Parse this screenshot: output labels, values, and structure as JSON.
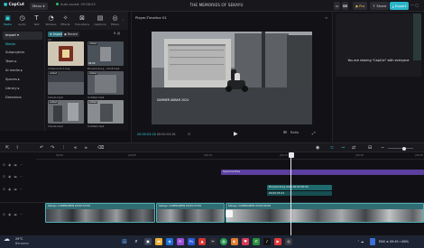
{
  "titlebar": {
    "app_name": "CapCut",
    "menu_label": "Menu",
    "autosave": "Auto saved: 09:58:53",
    "project_title": "THE MEMORIES OF SEKAYU",
    "pro_label": "Pro",
    "share_label": "Share",
    "export_label": "Export"
  },
  "media_tabs": [
    {
      "label": "Media",
      "icon": "film-icon"
    },
    {
      "label": "Audio",
      "icon": "audio-icon"
    },
    {
      "label": "Text",
      "icon": "text-icon"
    },
    {
      "label": "Stickers",
      "icon": "sticker-icon"
    },
    {
      "label": "Effects",
      "icon": "effects-icon"
    },
    {
      "label": "Transitions",
      "icon": "transition-icon"
    },
    {
      "label": "Captions",
      "icon": "caption-icon"
    },
    {
      "label": "Filters",
      "icon": "filter-icon"
    }
  ],
  "sidebar": {
    "items": [
      "Import",
      "Media",
      "Subprojects",
      "Team",
      "AI media",
      "Spaces",
      "Library",
      "Dreamina"
    ]
  },
  "media": {
    "import_label": "Import",
    "record_label": "Record",
    "section_label": "All",
    "thumbs": [
      {
        "name": "Unbenannt-1.png",
        "badge": "",
        "duration": ""
      },
      {
        "name": "Brandenburg_..Shelf.mp4",
        "badge": "Added",
        "duration": "00:05"
      },
      {
        "name": "Clouds.mp4",
        "badge": "Added",
        "duration": ""
      },
      {
        "name": "Untitled.mp4",
        "badge": "Added",
        "duration": ""
      },
      {
        "name": "Clouds.mp4",
        "badge": "Added",
        "duration": ""
      },
      {
        "name": "Untitled.mp4",
        "badge": "Added",
        "duration": ""
      },
      {
        "name": "Clouds.mp4",
        "badge": "Added",
        "duration": ""
      }
    ]
  },
  "player": {
    "title": "Player-Timeline 01",
    "current_time": "00:00:03:18",
    "total_time": "00:00:43:16",
    "subtitle": "SUMMER AKBAR 2024",
    "ratio_label": "Ratio"
  },
  "share_panel": {
    "message": "You are sharing \"CapCut\" with everyone"
  },
  "timeline": {
    "ruler": [
      "00:00",
      "|00:05",
      "|00:10",
      "|00:15",
      "|00:20",
      "|00:25"
    ],
    "clips": [
      {
        "label": "Opportunities",
        "track": 1
      },
      {
        "label": "Brandenburg Gate  00:00:00:00",
        "track": 2
      },
      {
        "label": "00:00:05:23",
        "track": 2
      },
      {
        "label": "Sekayu  CAMERAMEN  00:00:04:00",
        "track": 3
      },
      {
        "label": "Sekayu  CAMERAMEN  00:00:03:00",
        "track": 3
      },
      {
        "label": "Sekayu  CAMERAMEN  00:00:06:00",
        "track": 3
      }
    ]
  },
  "taskbar": {
    "weather_temp": "29°C",
    "weather_desc": "Berawan",
    "lang": "ENG",
    "time": "09:49",
    "battery": "80%"
  },
  "colors": {
    "accent": "#31d3e0",
    "clip_purple": "#5a3f9e",
    "clip_teal": "#1e6b6f",
    "taskbar": "#1d2433"
  }
}
